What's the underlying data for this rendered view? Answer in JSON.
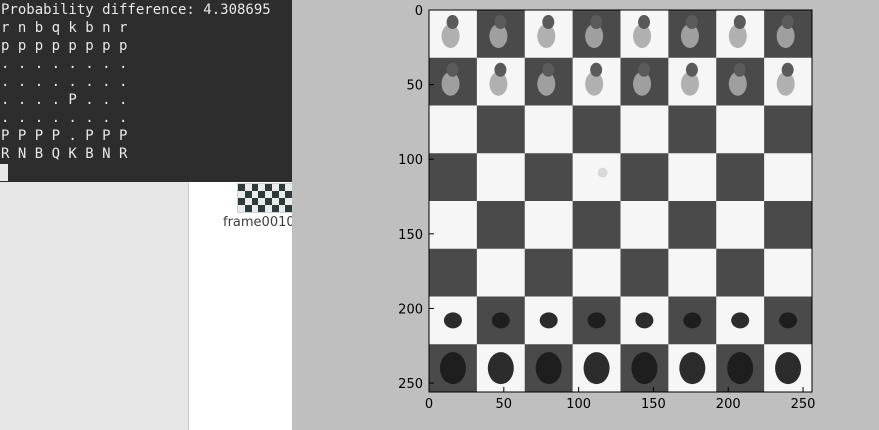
{
  "file_manager": {
    "thumbnail_label": "frame0010",
    "thumbnail_icon": "image-thumbnail-icon"
  },
  "terminal": {
    "lines": [
      "Probability difference: 4.308695",
      "r n b q k b n r",
      "p p p p p p p p",
      ". . . . . . . .",
      ". . . . . . . .",
      ". . . . P . . .",
      ". . . . . . . .",
      "P P P P . P P P",
      "R N B Q K B N R"
    ]
  },
  "chart_data": {
    "type": "image",
    "image_size": [
      256,
      256
    ],
    "x_ticks": [
      "0",
      "50",
      "100",
      "150",
      "200",
      "250"
    ],
    "y_ticks": [
      "0",
      "50",
      "100",
      "150",
      "200",
      "250"
    ],
    "xlim": [
      0,
      256
    ],
    "ylim": [
      256,
      0
    ],
    "board_grid": 8,
    "colormap": "grayscale",
    "pieces_top": "dark tops, light pieces",
    "pieces_bottom": "dark pieces"
  },
  "colors": {
    "terminal_bg": "#2d2d2d",
    "terminal_fg": "#e8e8e8",
    "figure_bg": "#bfbfbf",
    "dark_square": "#4a4a4a",
    "light_square": "#f6f6f6"
  }
}
